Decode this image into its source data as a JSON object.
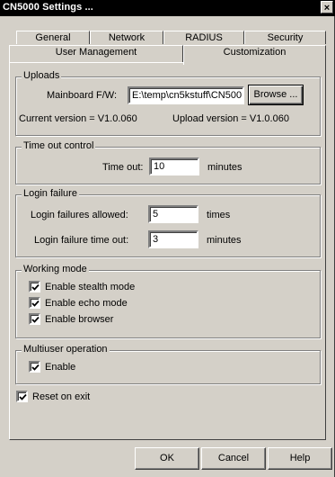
{
  "window": {
    "title": "CN5000 Settings ...",
    "close_label": "×"
  },
  "tabs": {
    "row1": [
      "General",
      "Network",
      "RADIUS",
      "Security"
    ],
    "row2": [
      "User Management",
      "Customization"
    ],
    "active": "Customization"
  },
  "uploads": {
    "label": "Uploads",
    "mainboard_label": "Mainboard F/W:",
    "mainboard_value": "E:\\temp\\cn5kstuff\\CN500",
    "browse_label": "Browse ...",
    "current_version": "Current version = V1.0.060",
    "upload_version": "Upload version = V1.0.060"
  },
  "timeout": {
    "label": "Time out control",
    "field_label": "Time out:",
    "value": "10",
    "unit": "minutes"
  },
  "login_failure": {
    "label": "Login failure",
    "allowed_label": "Login failures allowed:",
    "allowed_value": "5",
    "allowed_unit": "times",
    "timeout_label": "Login failure time out:",
    "timeout_value": "3",
    "timeout_unit": "minutes"
  },
  "working_mode": {
    "label": "Working mode",
    "options": [
      {
        "label": "Enable stealth mode",
        "checked": true
      },
      {
        "label": "Enable echo mode",
        "checked": true
      },
      {
        "label": "Enable browser",
        "checked": true
      }
    ]
  },
  "multiuser": {
    "label": "Multiuser operation",
    "enable_label": "Enable",
    "checked": true
  },
  "reset_on_exit": {
    "label": "Reset on exit",
    "checked": true
  },
  "buttons": {
    "ok": "OK",
    "cancel": "Cancel",
    "help": "Help"
  }
}
